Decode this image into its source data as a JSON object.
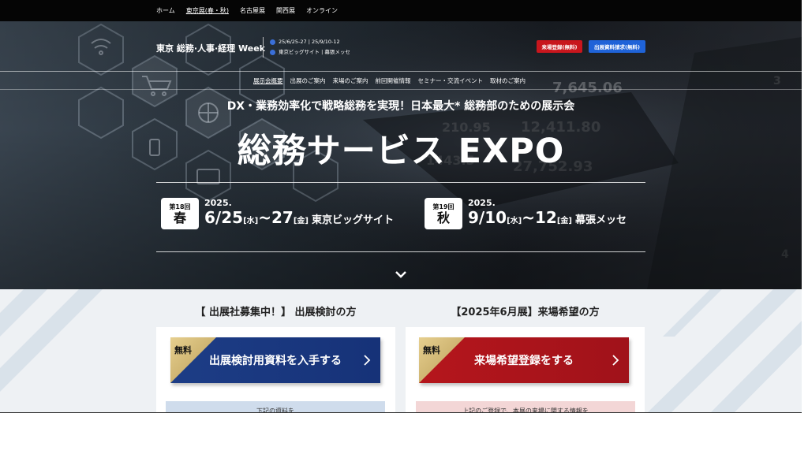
{
  "topnav": {
    "items": [
      {
        "label": "ホーム",
        "active": false
      },
      {
        "label": "東京展(春・秋)",
        "active": true
      },
      {
        "label": "名古屋展",
        "active": false
      },
      {
        "label": "関西展",
        "active": false
      },
      {
        "label": "オンライン",
        "active": false
      }
    ]
  },
  "header": {
    "brand": "東京 総務·人事·経理 Week",
    "dates_line": "25/6/25-27 | 25/9/10-12",
    "venue_line": "東京ビッグサイト | 幕張メッセ",
    "visit_button": "来場登録(無料)",
    "exhibit_button": "出展資料請求(無料)"
  },
  "subnav": {
    "items": [
      {
        "label": "展示会概要",
        "active": true
      },
      {
        "label": "出展のご案内",
        "active": false
      },
      {
        "label": "来場のご案内",
        "active": false
      },
      {
        "label": "前回開催情報",
        "active": false
      },
      {
        "label": "セミナー・交流イベント",
        "active": false
      },
      {
        "label": "取材のご案内",
        "active": false
      }
    ]
  },
  "hero": {
    "tagline": "DX・業務効率化で戦略総務を実現！日本最大* 総務部のための展示会",
    "title": "総務サービス EXPO",
    "editions": [
      {
        "number": "第18回",
        "season": "春",
        "year": "2025.",
        "start": "6/25",
        "start_dow": "[水]",
        "tilde": "~",
        "end": "27",
        "end_dow": "[金]",
        "venue": "東京ビッグサイト"
      },
      {
        "number": "第19回",
        "season": "秋",
        "year": "2025.",
        "start": "9/10",
        "start_dow": "[水]",
        "tilde": "~",
        "end": "12",
        "end_dow": "[金]",
        "venue": "幕張メッセ"
      }
    ],
    "scroll_icon": "chevron-down-icon"
  },
  "lower": {
    "exhibitor": {
      "heading": "【 出展社募集中！】 出展検討の方",
      "free_badge": "無料",
      "cta": "出展検討用資料を入手する",
      "sub_text": "下記の資料を"
    },
    "visitor": {
      "heading": "【2025年6月展】来場希望の方",
      "free_badge": "無料",
      "cta": "来場希望登録をする",
      "sub_text": "上記のご登録で、本展の来場に関する情報を"
    }
  },
  "colors": {
    "nav_bg": "#050505",
    "visit_red": "#c8161d",
    "exhibit_blue": "#1f63d8",
    "cta_blue": "#1d3d86",
    "cta_red": "#b5161c",
    "gold": "#d6bb72"
  }
}
